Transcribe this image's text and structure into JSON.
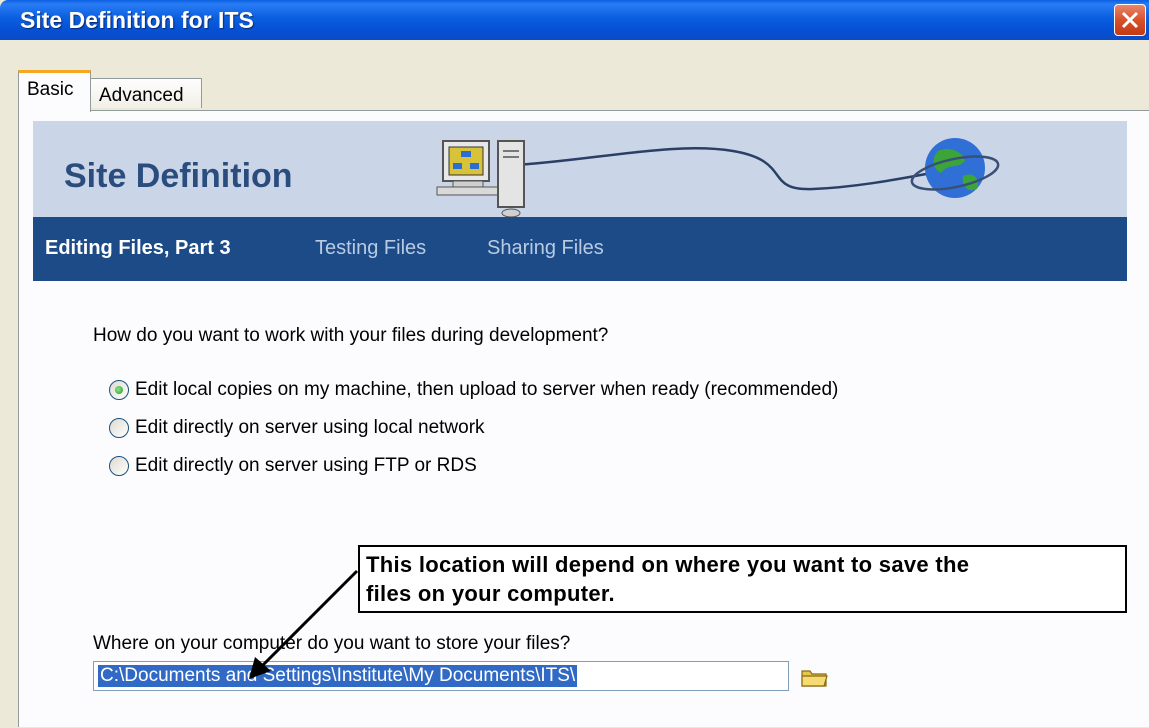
{
  "window": {
    "title": "Site Definition for ITS"
  },
  "tabs": [
    {
      "label": "Basic",
      "active": true
    },
    {
      "label": "Advanced",
      "active": false
    }
  ],
  "banner": {
    "title": "Site Definition"
  },
  "wizard_steps": [
    {
      "label": "Editing Files, Part 3",
      "active": true
    },
    {
      "label": "Testing Files",
      "active": false
    },
    {
      "label": "Sharing Files",
      "active": false
    }
  ],
  "question": "How do you want to work with your files during development?",
  "options": [
    {
      "label": "Edit local copies on my machine, then upload to server when ready (recommended)",
      "selected": true
    },
    {
      "label": "Edit directly on server using local network",
      "selected": false
    },
    {
      "label": "Edit directly on server using FTP or RDS",
      "selected": false
    }
  ],
  "callout": {
    "line1": "This location will depend on where you want to save the",
    "line2": "files on your computer."
  },
  "storage": {
    "label": "Where on your computer do you want to store your files?",
    "path": "C:\\Documents and Settings\\Institute\\My Documents\\ITS\\"
  },
  "icons": {
    "close": "close-icon",
    "folder": "folder-icon",
    "computer": "computer-icon",
    "globe": "globe-icon"
  },
  "colors": {
    "titlebar": "#0a5fe0",
    "banner": "#cad6e8",
    "navbar": "#1c4b87",
    "selection": "#316ac5",
    "radio_dot": "#21a121"
  }
}
